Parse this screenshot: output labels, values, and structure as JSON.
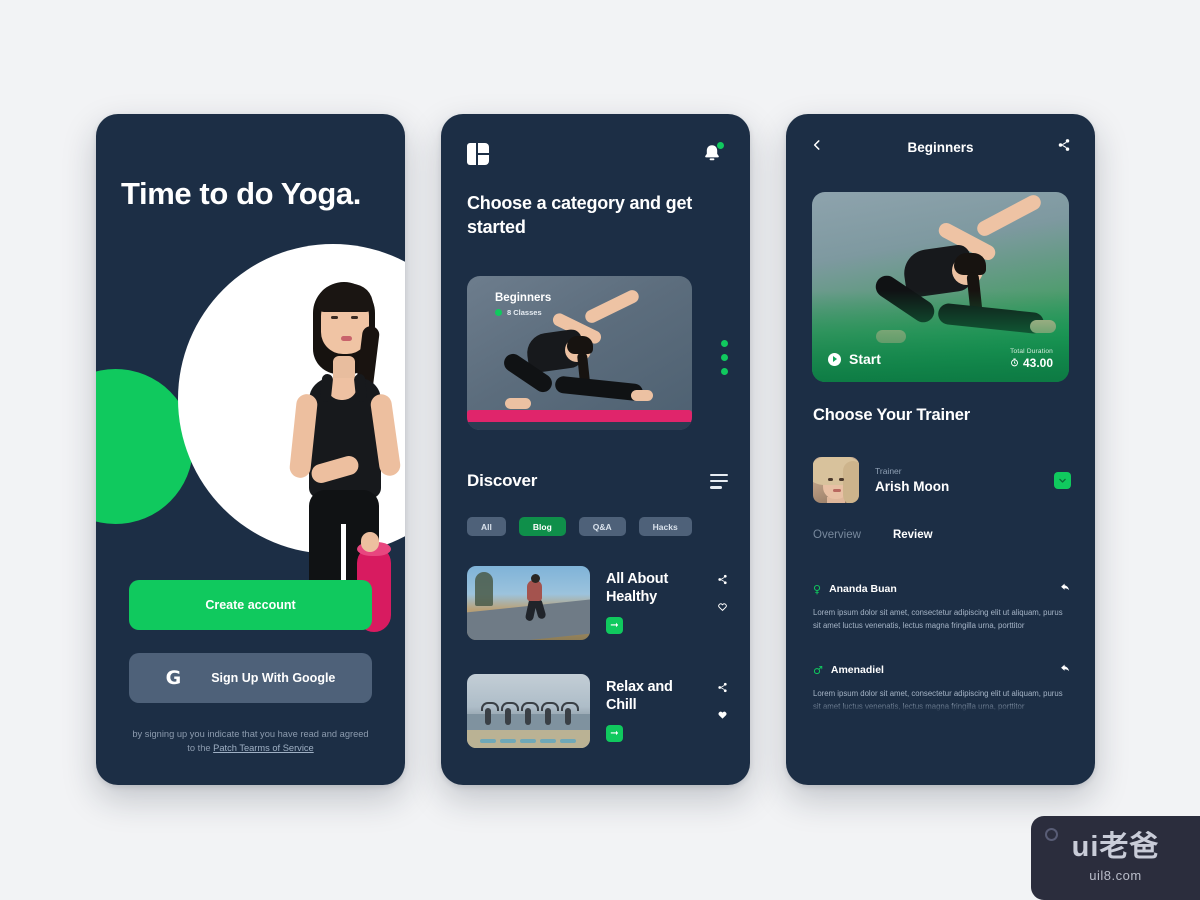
{
  "screen1": {
    "headline": "Time to do Yoga.",
    "create_account_label": "Create account",
    "google_label": "Sign Up With Google",
    "google_icon": "google-g-icon",
    "legal_text": "by signing up you indicate that you have read and agreed to the ",
    "legal_link": "Patch Tearms of Service"
  },
  "screen2": {
    "logo_icon": "app-logo-icon",
    "bell_icon": "notification-bell-icon",
    "headline": "Choose a category and get started",
    "category_card": {
      "title": "Beginners",
      "classes": "8 Classes"
    },
    "discover_title": "Discover",
    "filter_icon": "filter-icon",
    "chips": [
      {
        "label": "All",
        "active": false
      },
      {
        "label": "Blog",
        "active": true
      },
      {
        "label": "Q&A",
        "active": false
      },
      {
        "label": "Hacks",
        "active": false
      }
    ],
    "articles": [
      {
        "title": "All About Healthy",
        "share_icon": "share-icon",
        "like_icon": "heart-outline-icon",
        "go_icon": "arrow-right-icon"
      },
      {
        "title": "Relax and Chill",
        "share_icon": "share-icon",
        "like_icon": "heart-filled-icon",
        "go_icon": "arrow-right-icon"
      }
    ]
  },
  "screen3": {
    "back_icon": "chevron-left-icon",
    "title": "Beginners",
    "share_icon": "share-icon",
    "start_label": "Start",
    "play_icon": "play-icon",
    "duration_label": "Total Duration",
    "duration_value": "43.00",
    "timer_icon": "timer-icon",
    "trainer_heading": "Choose Your Trainer",
    "trainer": {
      "role": "Trainer",
      "name": "Arish Moon",
      "chevron_icon": "chevron-down-icon",
      "avatar": "trainer-avatar"
    },
    "tabs": [
      {
        "label": "Overview",
        "active": false
      },
      {
        "label": "Review",
        "active": true
      }
    ],
    "reviews": [
      {
        "name": "Ananda Buan",
        "gender_icon": "female-icon",
        "gender_glyph": "♀",
        "reply_icon": "reply-icon",
        "text": "Lorem ipsum dolor sit amet, consectetur adipiscing elit ut aliquam, purus sit amet luctus venenatis, lectus magna fringilla urna, porttitor"
      },
      {
        "name": "Amenadiel",
        "gender_icon": "male-icon",
        "gender_glyph": "♂",
        "reply_icon": "reply-icon",
        "text": "Lorem ipsum dolor sit amet, consectetur adipiscing elit ut aliquam, purus sit amet luctus venenatis, lectus magna fringilla urna, porttitor"
      }
    ]
  },
  "watermark": {
    "main": "ui老爸",
    "sub": "uil8.com"
  },
  "colors": {
    "navy": "#1c2e45",
    "green": "#10c95e",
    "green_dark": "#0f8f4a",
    "slate": "#4e6179",
    "page_bg": "#f2f3f5",
    "mat_pink": "#e0256b"
  }
}
